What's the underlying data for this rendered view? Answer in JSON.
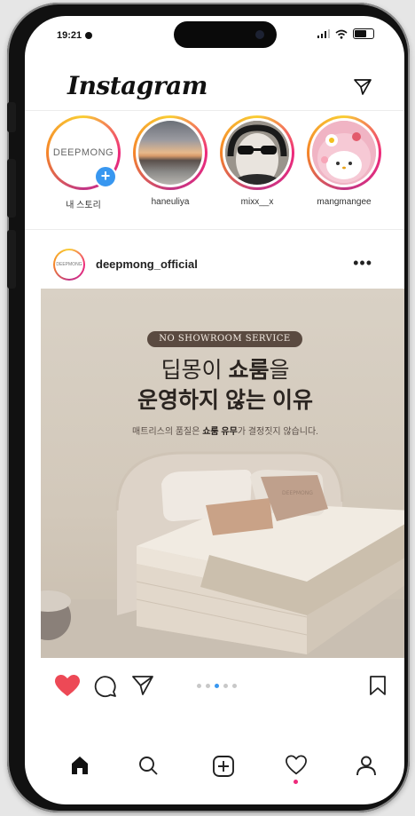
{
  "status_bar": {
    "time": "19:21"
  },
  "header": {
    "logo": "Instagram"
  },
  "stories": [
    {
      "label": "내 스토리",
      "avatar_text": "DEEPMONG"
    },
    {
      "label": "haneuliya"
    },
    {
      "label": "mixx__x"
    },
    {
      "label": "mangmangee"
    }
  ],
  "post": {
    "username": "deepmong_official",
    "avatar_text": "DEEPMONG",
    "more": "•••",
    "image": {
      "pill": "NO SHOWROOM SERVICE",
      "headline_1a": "딥몽이 ",
      "headline_1b": "쇼룸",
      "headline_1c": "을",
      "headline_2": "운영하지 않는 이유",
      "sub_a": "매트리스의 품질은 ",
      "sub_b": "쇼룸 유무",
      "sub_c": "가 결정짓지 않습니다.",
      "pillow_text": "DEEPMONG"
    },
    "carousel": {
      "count": 5,
      "active_index": 2
    },
    "liked": true
  },
  "colors": {
    "like": "#ed4956",
    "accent": "#3897f0",
    "ring_start": "#f9ce34",
    "ring_end": "#ee2a7b"
  },
  "bottom_nav": [
    "home-icon",
    "search-icon",
    "add-icon",
    "heart-icon",
    "profile-icon"
  ]
}
